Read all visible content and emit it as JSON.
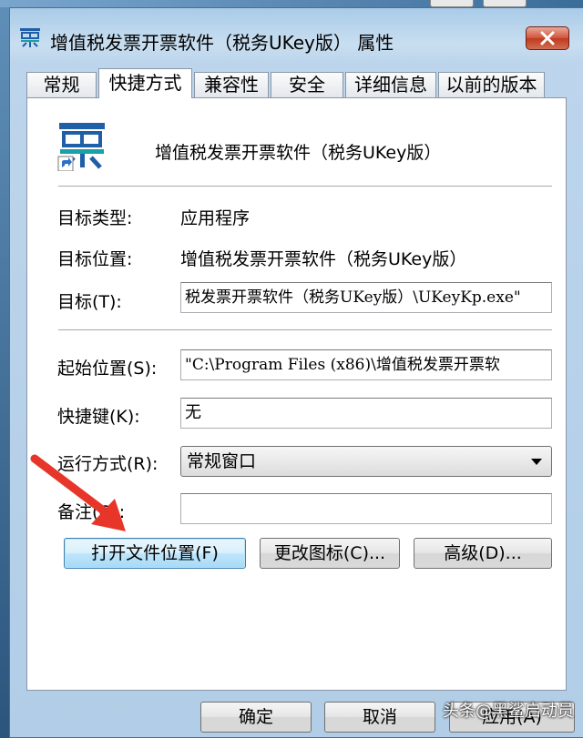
{
  "window": {
    "title": "增值税发票开票软件（税务UKey版） 属性",
    "close_label": "✕"
  },
  "tabs": [
    {
      "label": "常规"
    },
    {
      "label": "快捷方式"
    },
    {
      "label": "兼容性"
    },
    {
      "label": "安全"
    },
    {
      "label": "详细信息"
    },
    {
      "label": "以前的版本"
    }
  ],
  "shortcut": {
    "program_name": "增值税发票开票软件（税务UKey版）",
    "target_type_label": "目标类型:",
    "target_type_value": "应用程序",
    "target_location_label": "目标位置:",
    "target_location_value": "增值税发票开票软件（税务UKey版）",
    "target_label": "目标(T):",
    "target_value": "税发票开票软件（税务UKey版）\\UKeyKp.exe\"",
    "start_in_label": "起始位置(S):",
    "start_in_value": "\"C:\\Program Files (x86)\\增值税发票开票软",
    "shortcut_key_label": "快捷键(K):",
    "shortcut_key_value": "无",
    "run_label": "运行方式(R):",
    "run_value": "常规窗口",
    "comment_label": "备注(O):",
    "comment_value": "",
    "open_location_button": "打开文件位置(F)",
    "change_icon_button": "更改图标(C)...",
    "advanced_button": "高级(D)..."
  },
  "footer": {
    "ok_button": "确定",
    "cancel_button": "取消",
    "apply_button": "应用(A)"
  },
  "watermark": "头条@黑鲨启动员",
  "colors": {
    "arrow": "#e8352a",
    "icon_blue": "#1f5fa8",
    "icon_teal": "#1aa0a6"
  }
}
